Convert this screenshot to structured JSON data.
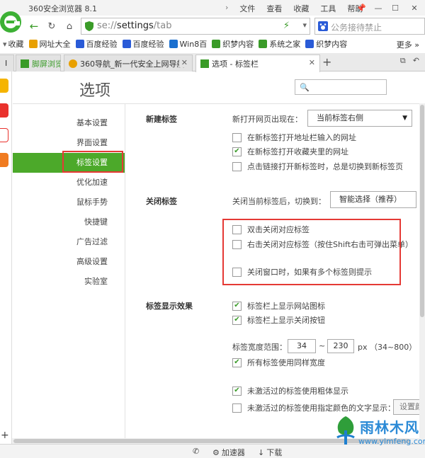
{
  "window": {
    "title": "360安全浏览器 8.1",
    "menu": [
      "文件",
      "查看",
      "收藏",
      "工具",
      "帮助"
    ],
    "controls": {
      "pin": "📌",
      "minimize": "—",
      "maximize": "☐",
      "close": "✕"
    }
  },
  "navbar": {
    "back_icon": "arrow-left-icon",
    "address_prefix": "se://",
    "address_path": "settings",
    "address_suffix": "/tab",
    "search_text": "公务接待禁止"
  },
  "bookmarks": {
    "favorites_label": "收藏",
    "items": [
      {
        "label": "网址大全",
        "color": "#e8a000"
      },
      {
        "label": "百度经验",
        "color": "#2a5bd7"
      },
      {
        "label": "百度经验",
        "color": "#2a5bd7"
      },
      {
        "label": "Win8百",
        "color": "#1a6fcf"
      },
      {
        "label": "织梦内容",
        "color": "#3a9b28"
      },
      {
        "label": "系统之家",
        "color": "#3a9b28"
      },
      {
        "label": "织梦内容",
        "color": "#2a5bd7"
      }
    ],
    "more_label": "更多"
  },
  "tabs": [
    {
      "label": "I",
      "active": false
    },
    {
      "label": "脚屏浏览",
      "active": false
    },
    {
      "label": "360导航_新一代安全上网导航",
      "active": false
    },
    {
      "label": "选项 - 标签栏",
      "active": true
    }
  ],
  "page": {
    "title": "选项",
    "nav": [
      {
        "label": "基本设置",
        "active": false
      },
      {
        "label": "界面设置",
        "active": false
      },
      {
        "label": "标签设置",
        "active": true
      },
      {
        "label": "优化加速",
        "active": false
      },
      {
        "label": "鼠标手势",
        "active": false
      },
      {
        "label": "快捷键",
        "active": false
      },
      {
        "label": "广告过滤",
        "active": false
      },
      {
        "label": "高级设置",
        "active": false
      },
      {
        "label": "实验室",
        "active": false
      }
    ]
  },
  "new_tab": {
    "title": "新建标签",
    "open_position_label": "新打开网页出现在：",
    "open_position_value": "当前标签右侧",
    "options": [
      {
        "label": "在新标签打开地址栏输入的网址",
        "checked": false
      },
      {
        "label": "在新标签打开收藏夹里的网址",
        "checked": true
      },
      {
        "label": "点击链接打开新标签时，总是切换到新标签页",
        "checked": false
      }
    ]
  },
  "close_tab": {
    "title": "关闭标签",
    "switch_label": "关闭当前标签后，切换到：",
    "switch_value": "智能选择（推荐）",
    "options": [
      {
        "label": "双击关闭对应标签",
        "checked": false
      },
      {
        "label": "右击关闭对应标签（按住Shift右击可弹出菜单）",
        "checked": false
      },
      {
        "label": "关闭窗口时，如果有多个标签则提示",
        "checked": false
      }
    ]
  },
  "tab_display": {
    "title": "标签显示效果",
    "options": [
      {
        "label": "标签栏上显示网站图标",
        "checked": true
      },
      {
        "label": "标签栏上显示关闭按钮",
        "checked": true
      }
    ],
    "width_label": "标签宽度范围：",
    "width_min": "34",
    "width_sep": "~",
    "width_max": "230",
    "width_hint": "px （34~800）",
    "same_width": {
      "label": "所有标签使用同样宽度",
      "checked": true
    },
    "bold_inactive": {
      "label": "未激活过的标签使用粗体显示",
      "checked": true
    },
    "color_inactive": {
      "label": "未激活过的标签使用指定颜色的文字显示：",
      "checked": false
    },
    "color_button": "设置颜色"
  },
  "statusbar": {
    "accelerator": "加速器",
    "download": "下载"
  },
  "watermark": {
    "brand": "雨林木风",
    "url": "www.ylmfeng.com"
  },
  "colors": {
    "accent_green": "#4ca92a",
    "highlight_red": "#e53935",
    "watermark_blue": "#2b8ad6"
  }
}
